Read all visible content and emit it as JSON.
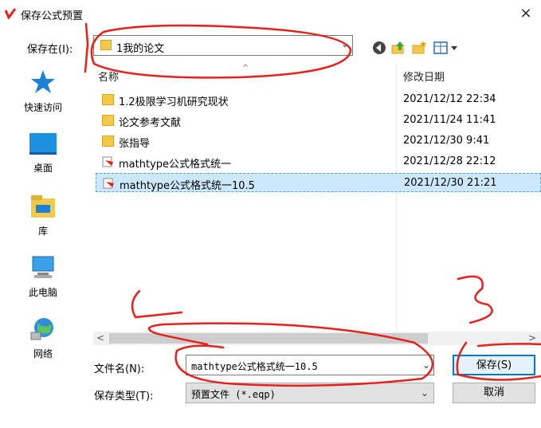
{
  "window": {
    "title": "保存公式预置",
    "close_glyph": "×"
  },
  "save_in": {
    "label": "保存在(I):",
    "value": "1我的论文"
  },
  "places": [
    {
      "label": "快速访问",
      "icon": "star-icon"
    },
    {
      "label": "桌面",
      "icon": "desktop-icon"
    },
    {
      "label": "库",
      "icon": "library-icon"
    },
    {
      "label": "此电脑",
      "icon": "computer-icon"
    },
    {
      "label": "网络",
      "icon": "network-icon"
    }
  ],
  "columns": {
    "name": "名称",
    "date": "修改日期"
  },
  "files": [
    {
      "name": "1.2极限学习机研究现状",
      "date": "2021/12/12 22:34",
      "type": "folder"
    },
    {
      "name": "论文参考文献",
      "date": "2021/11/24 11:41",
      "type": "folder"
    },
    {
      "name": "张指导",
      "date": "2021/12/30 9:41",
      "type": "folder"
    },
    {
      "name": "mathtype公式格式统一",
      "date": "2021/12/28 22:12",
      "type": "file"
    },
    {
      "name": "mathtype公式格式统一10.5",
      "date": "2021/12/30 21:21",
      "type": "file",
      "selected": true
    }
  ],
  "form": {
    "filename_label": "文件名(N):",
    "filename_value": "mathtype公式格式统一10.5",
    "filetype_label": "保存类型(T):",
    "filetype_value": "预置文件 (*.eqp)"
  },
  "buttons": {
    "save": "保存(S)",
    "cancel": "取消"
  },
  "colors": {
    "accent": "#0078d7",
    "selection": "#cce8ff",
    "annotation": "#e8201a"
  }
}
